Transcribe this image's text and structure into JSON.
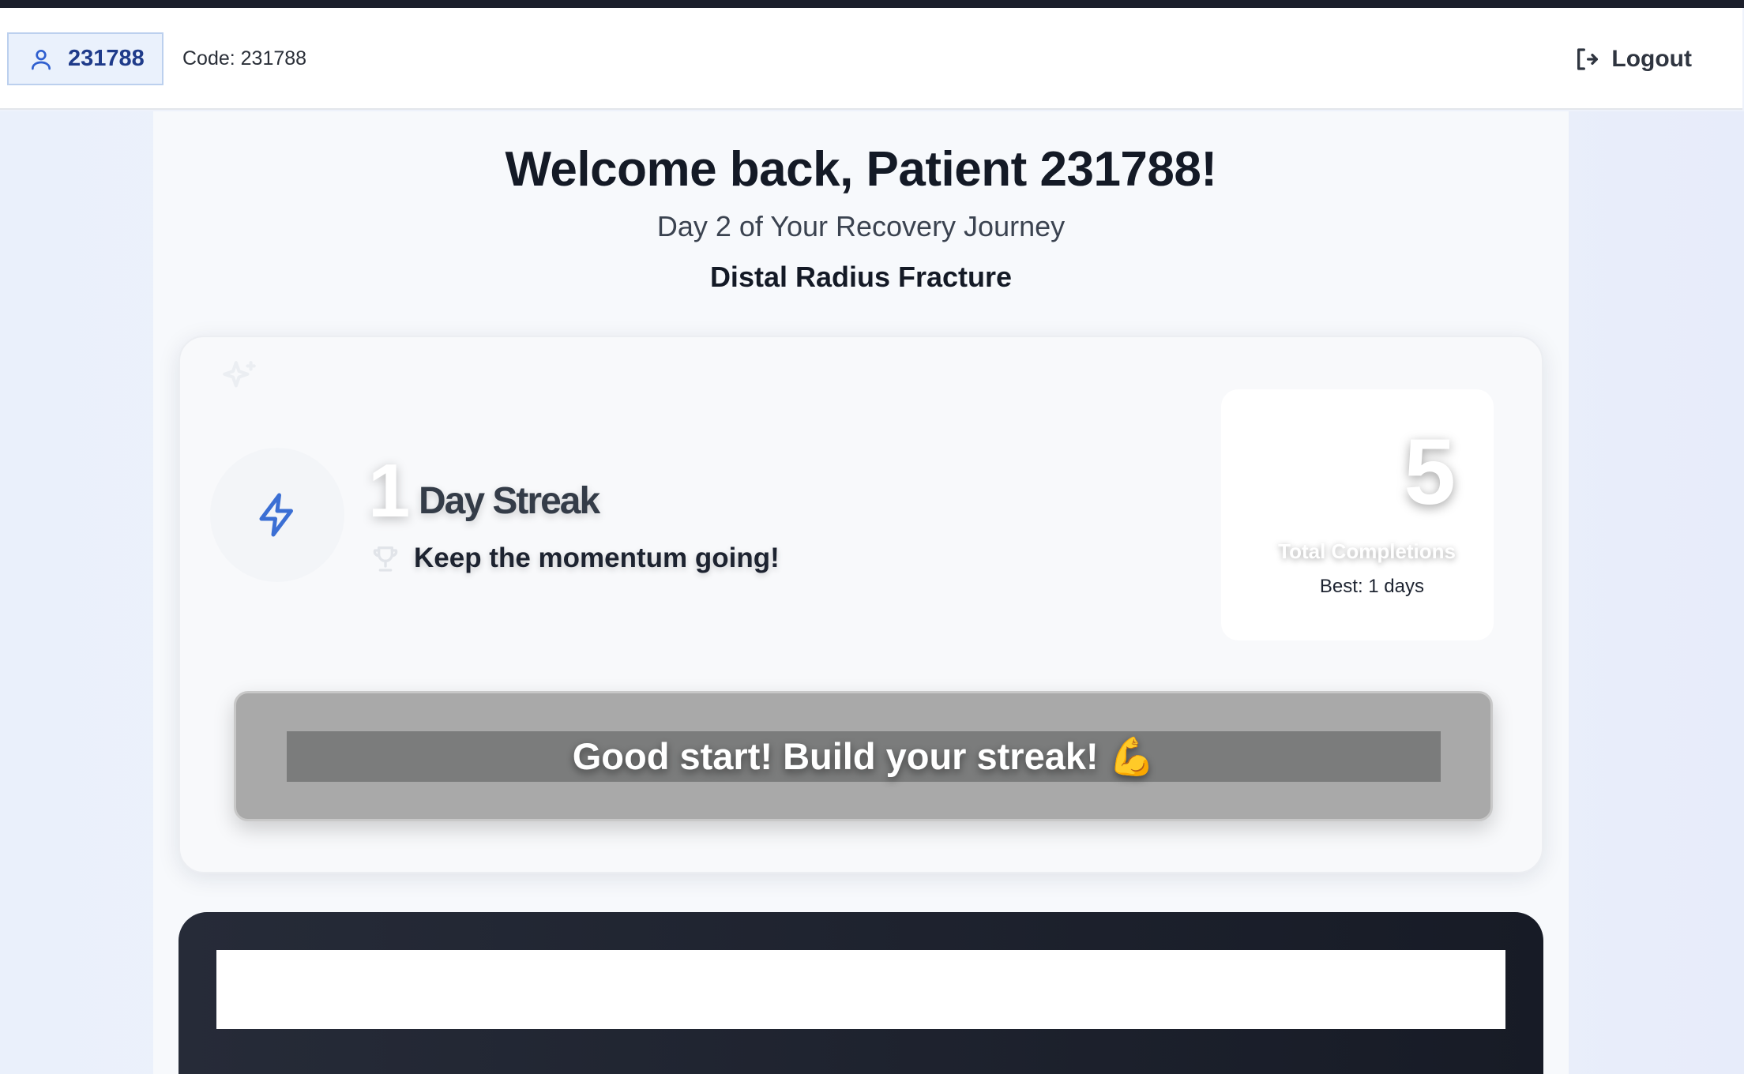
{
  "header": {
    "user_id": "231788",
    "code_text": "Code: 231788",
    "logout_label": "Logout"
  },
  "main": {
    "welcome": "Welcome back, Patient 231788!",
    "journey": "Day 2 of Your Recovery Journey",
    "condition": "Distal Radius Fracture"
  },
  "streak": {
    "count": "1",
    "label": "Day Streak",
    "message": "Keep the momentum going!",
    "total_completions": "5",
    "total_label": "Total Completions",
    "best": "Best: 1 days",
    "motivation": "Good start! Build your streak! 💪"
  },
  "colors": {
    "accent": "#3b6fd4",
    "header_chip_bg": "#eaf1fc",
    "dark_panel": "#1b1f2b"
  }
}
